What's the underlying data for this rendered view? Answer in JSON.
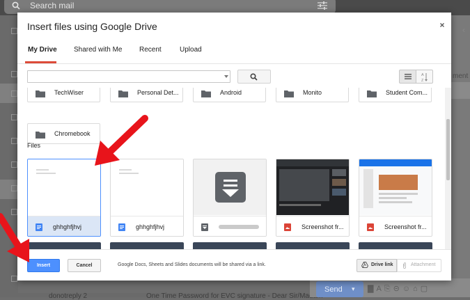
{
  "background": {
    "search_placeholder": "Search mail",
    "right_pane_text": "ment M",
    "compose": {
      "send_label": "Send"
    },
    "mail_row": {
      "sender": "donotreply 2",
      "subject": "One Time Password for EVC signature - Dear Sir/Madam"
    }
  },
  "dialog": {
    "title": "Insert files using Google Drive",
    "close_glyph": "×",
    "tabs": [
      {
        "label": "My Drive",
        "active": true
      },
      {
        "label": "Shared with Me",
        "active": false
      },
      {
        "label": "Recent",
        "active": false
      },
      {
        "label": "Upload",
        "active": false
      }
    ],
    "search_value": "",
    "folders": [
      {
        "label": "TechWiser"
      },
      {
        "label": "Personal Det..."
      },
      {
        "label": "Android"
      },
      {
        "label": "Monito"
      },
      {
        "label": "Student Com..."
      },
      {
        "label": "Chromebook"
      }
    ],
    "files_heading": "Files",
    "files": [
      {
        "name": "ghhghfjhvj",
        "type": "doc",
        "selected": true
      },
      {
        "name": "ghhghfjhvj",
        "type": "doc",
        "selected": false
      },
      {
        "name": "",
        "type": "download",
        "selected": false
      },
      {
        "name": "Screenshot fr...",
        "type": "image",
        "selected": false
      },
      {
        "name": "Screenshot fr...",
        "type": "image",
        "selected": false
      }
    ],
    "footer": {
      "insert_label": "Insert",
      "cancel_label": "Cancel",
      "share_note": "Google Docs, Sheets and Slides documents will be shared via a link.",
      "drive_link_label": "Drive link",
      "attachment_label": "Attachment"
    }
  },
  "colors": {
    "accent_blue": "#4d90fe",
    "tab_underline": "#dd4b39",
    "annotation_arrow": "#e8141b",
    "doc_icon": "#4285f4",
    "image_icon": "#db4437"
  },
  "annotations": {
    "arrow_count": 2
  }
}
